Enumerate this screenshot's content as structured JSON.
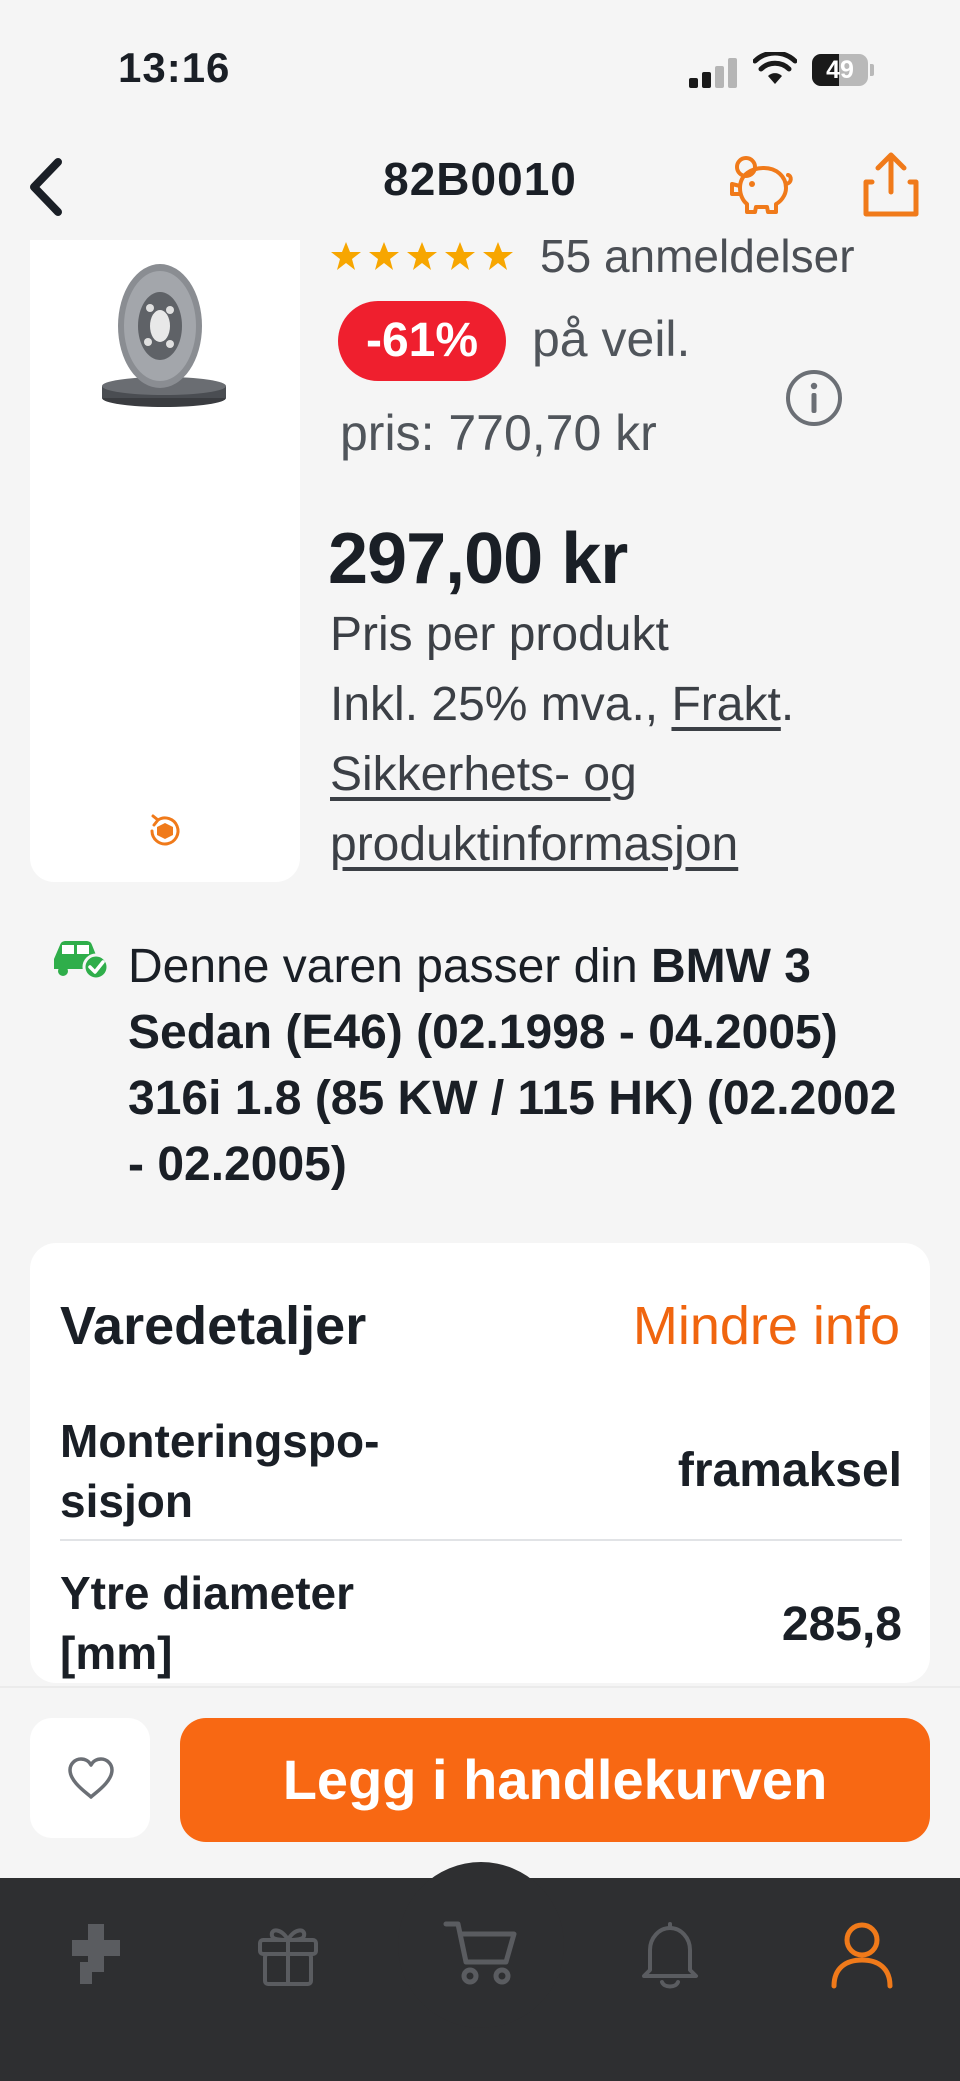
{
  "status_bar": {
    "time": "13:16",
    "battery_level": "49"
  },
  "header": {
    "title": "82B0010",
    "back_icon": "chevron-left-icon",
    "piggy_icon": "piggy-bank-icon",
    "share_icon": "share-icon"
  },
  "product": {
    "rating_stars": 5,
    "review_count": "55 anmeldelser",
    "discount": "-61%",
    "rrp_line1": "på veil.",
    "rrp_line2": "pris: 770,70 kr",
    "price": "297,00 kr",
    "price_note": "Pris per produkt",
    "vat_text": "Inkl. 25% mva., ",
    "shipping_link": "Frakt",
    "period": ".",
    "safety_link_line1": "Sikkerhets- og",
    "safety_link_line2": "produktinformasjon"
  },
  "fitment": {
    "prefix": "Denne varen passer din ",
    "vehicle": "BMW 3 Sedan (E46) (02.1998 - 04.2005) 316i 1.8 (85 KW / 115 HK) (02.2002 - 02.2005)"
  },
  "details": {
    "title": "Varedetaljer",
    "toggle_label": "Mindre info",
    "rows": [
      {
        "label_line1": "Monteringspo-",
        "label_line2": "sisjon",
        "value": "framaksel"
      },
      {
        "label_line1": "Ytre diameter",
        "label_line2": "[mm]",
        "value": "285,8"
      }
    ]
  },
  "actions": {
    "add_to_cart_label": "Legg i handlekurven",
    "wishlist_icon": "heart-icon"
  },
  "tab_bar": {
    "tabs": [
      "home-icon",
      "gift-icon",
      "cart-icon",
      "bell-icon",
      "profile-icon"
    ],
    "active": "profile-icon"
  },
  "colors": {
    "accent": "#f86813",
    "discount": "#ef1f2e",
    "star": "#f7a600",
    "fit_ok": "#2fae4a",
    "tab_bar": "#2e2f31"
  }
}
